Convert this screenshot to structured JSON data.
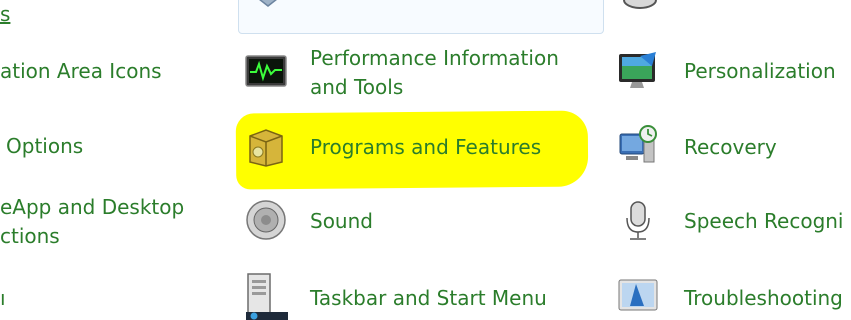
{
  "left_column": {
    "row0": "s",
    "row1": "ation Area Icons",
    "row2": "Options",
    "row3_line1": "eApp and Desktop",
    "row3_line2": "ctions",
    "row4": "ı"
  },
  "middle_column": {
    "performance": "Performance Information and Tools",
    "programs": "Programs and Features",
    "sound": "Sound",
    "taskbar": "Taskbar and Start Menu"
  },
  "right_column": {
    "personalization": "Personalization",
    "recovery": "Recovery",
    "speech": "Speech Recogni",
    "troubleshooting": "Troubleshooting"
  },
  "colors": {
    "link_green": "#2b7d2b",
    "highlight_yellow": "#ffff00"
  },
  "icons": {
    "performance": "performance-monitor-icon",
    "programs": "programs-box-icon",
    "sound": "speaker-icon",
    "taskbar": "taskbar-icon",
    "personalization": "personalization-monitor-icon",
    "recovery": "recovery-computer-icon",
    "speech": "microphone-icon",
    "troubleshooting": "troubleshooting-icon"
  }
}
